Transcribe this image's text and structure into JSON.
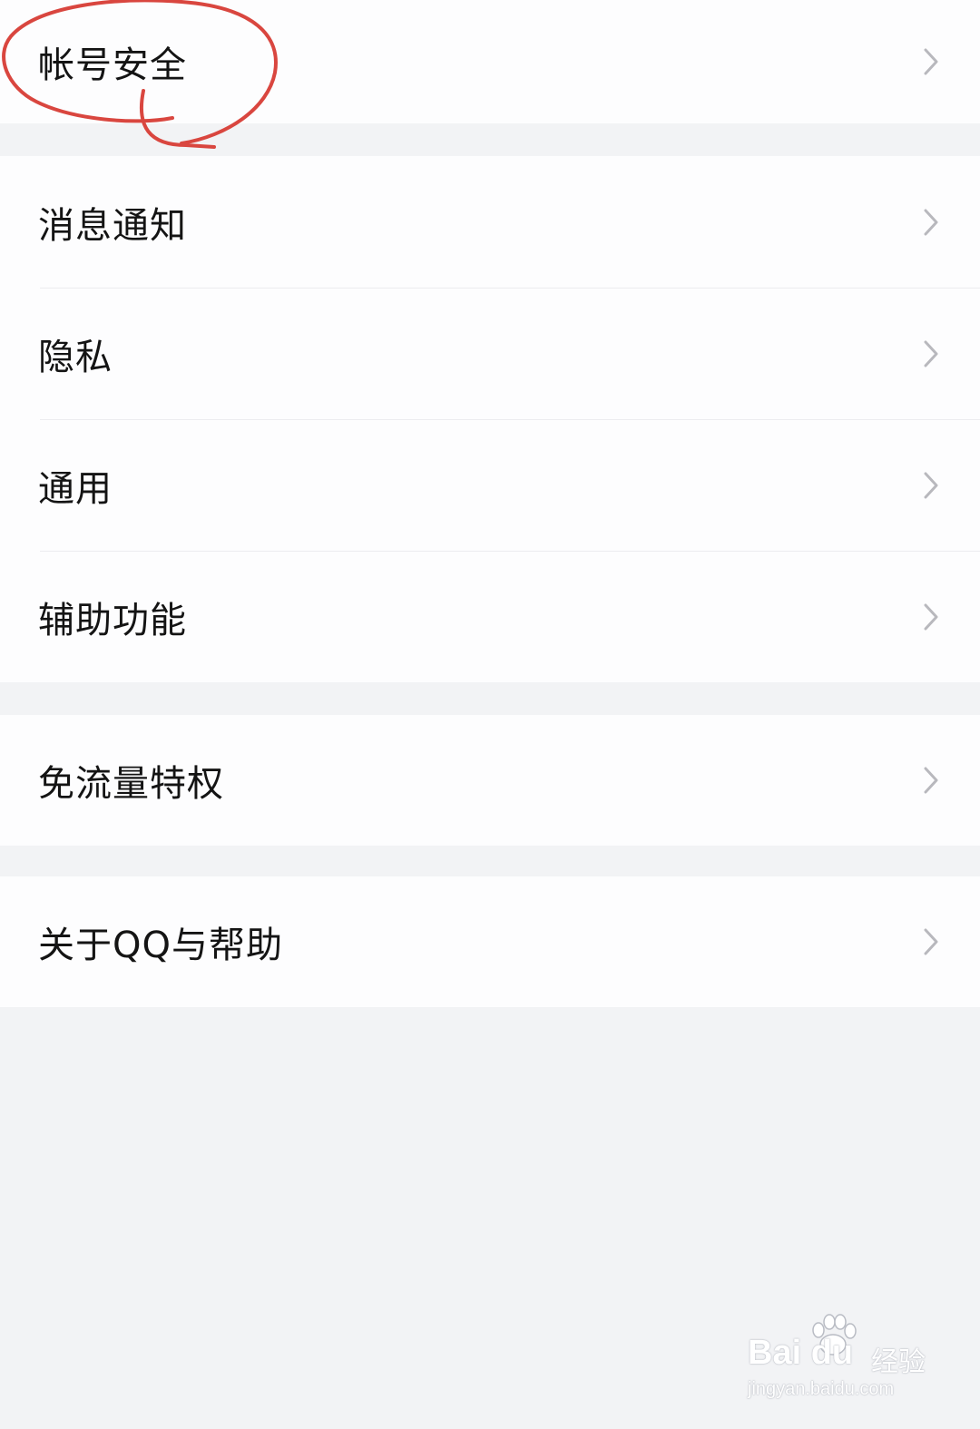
{
  "settings": {
    "groups": [
      {
        "items": [
          {
            "label": "帐号安全"
          }
        ]
      },
      {
        "items": [
          {
            "label": "消息通知"
          },
          {
            "label": "隐私"
          },
          {
            "label": "通用"
          },
          {
            "label": "辅助功能"
          }
        ]
      },
      {
        "items": [
          {
            "label": "免流量特权"
          }
        ]
      },
      {
        "items": [
          {
            "label": "关于QQ与帮助"
          }
        ]
      }
    ]
  },
  "icons": {
    "row_arrow": "chevron-right-icon"
  },
  "annotation": {
    "circled_item": "帐号安全",
    "stroke_color": "#d9463f"
  },
  "watermark": {
    "brand": "Bai du",
    "product": "经验",
    "url": "jingyan.baidu.com"
  },
  "colors": {
    "page_background": "#f2f3f5",
    "card_background": "#fdfdfe",
    "text": "#141414",
    "chevron": "#b8b8bd",
    "divider": "#ececef"
  }
}
